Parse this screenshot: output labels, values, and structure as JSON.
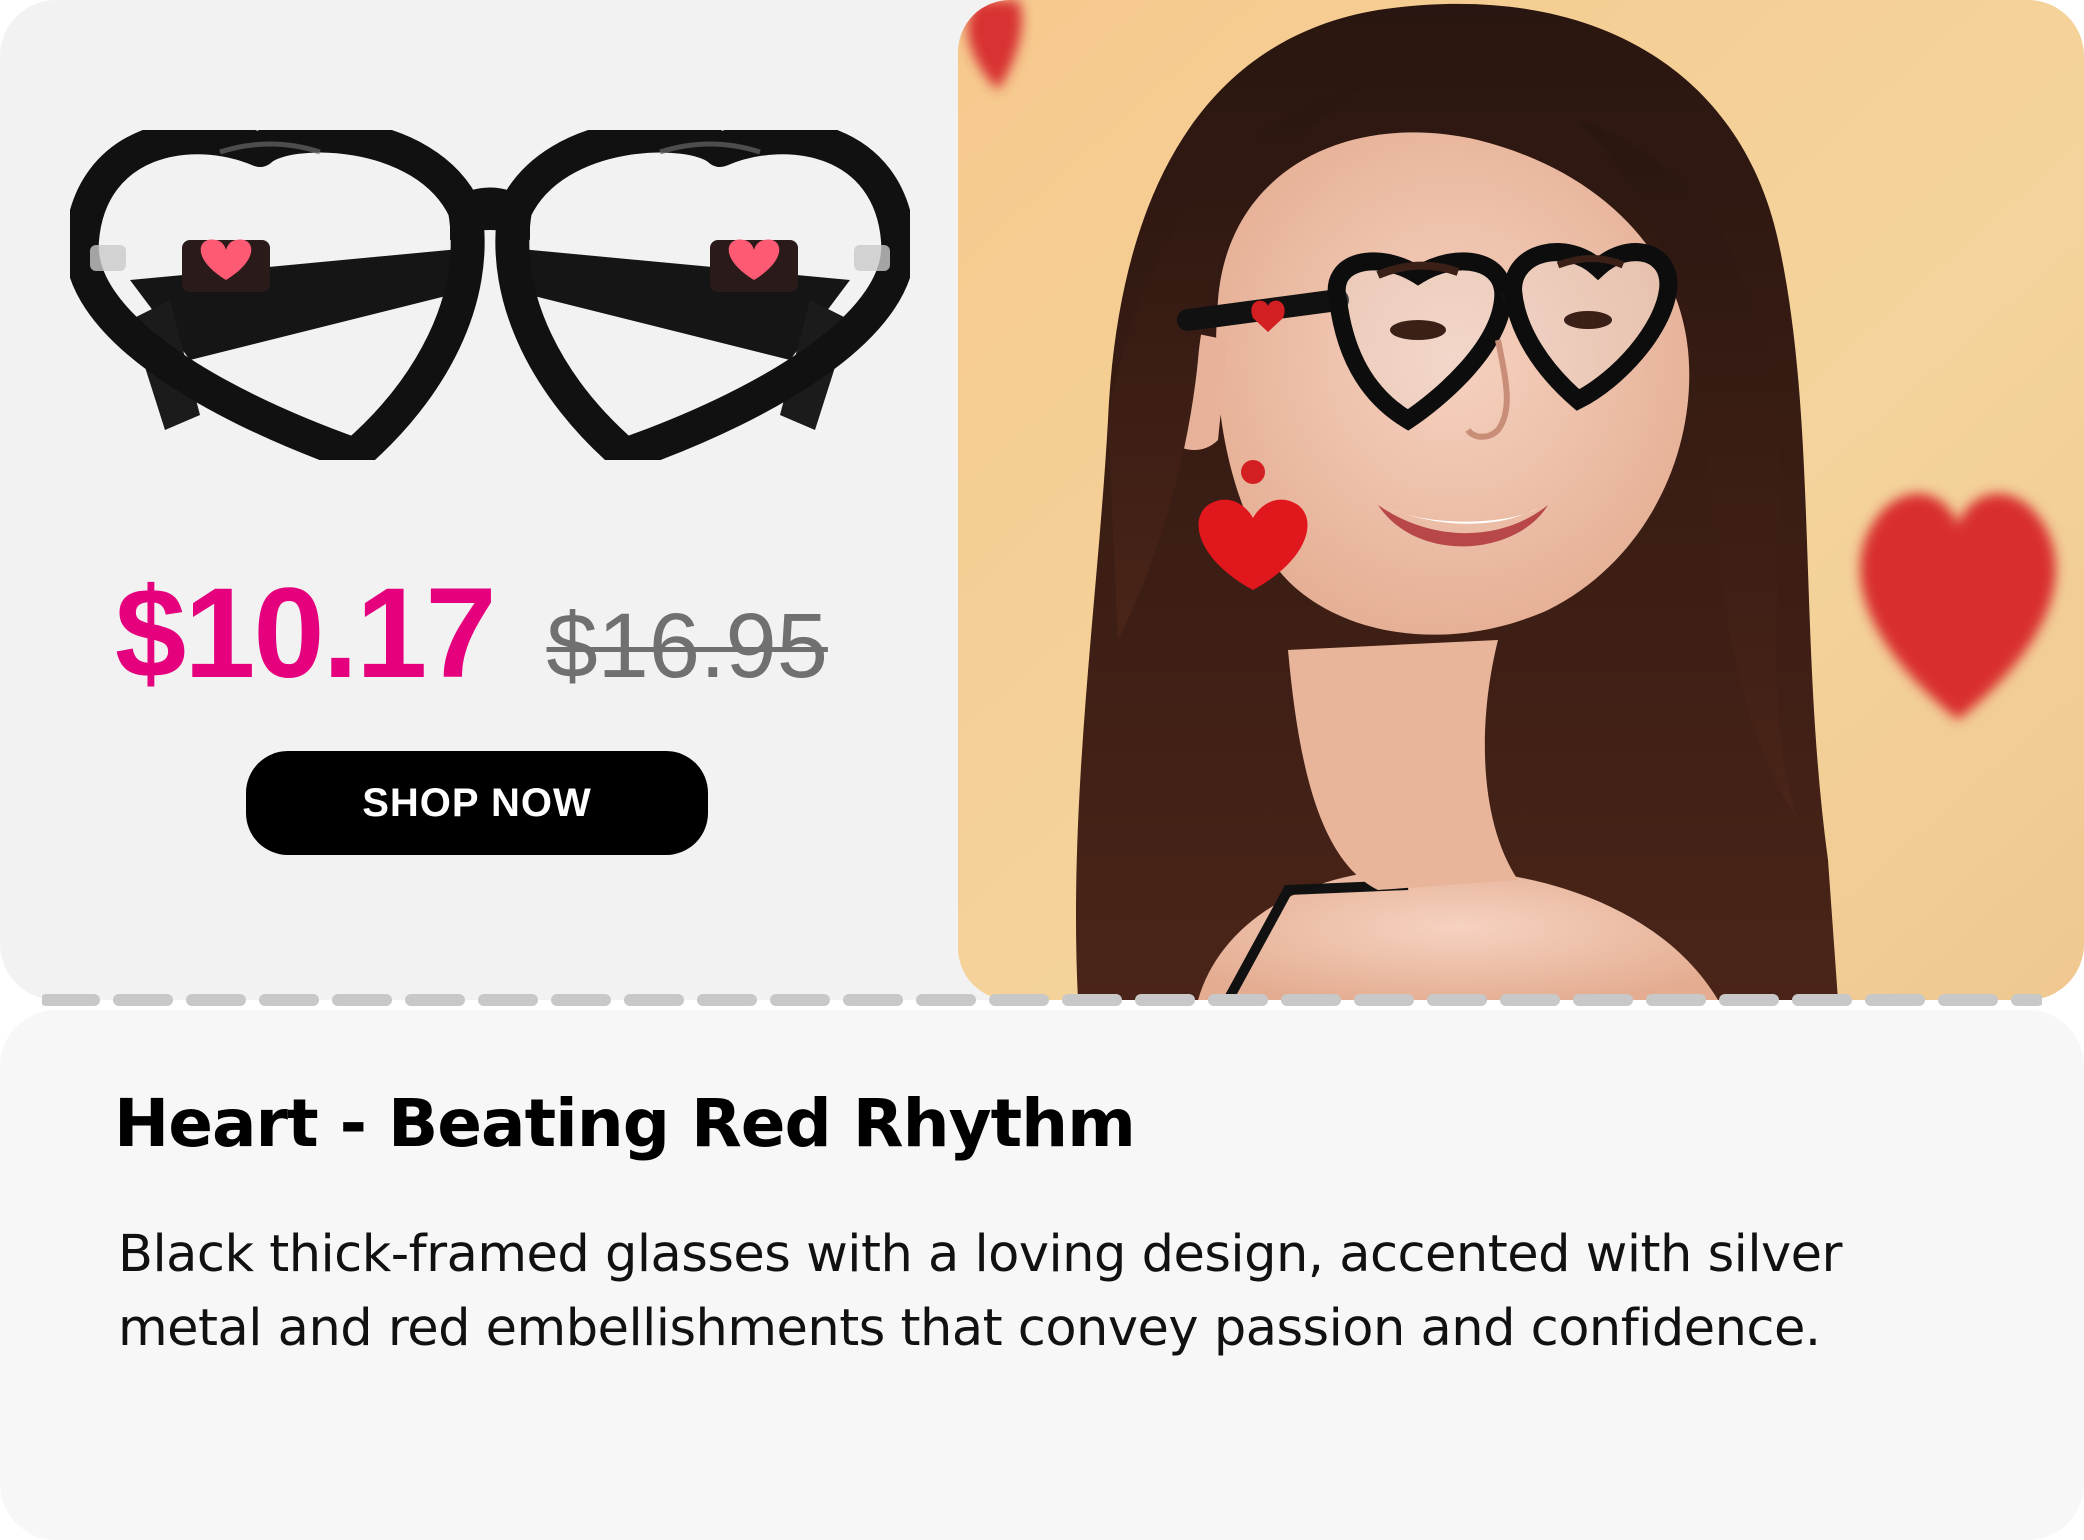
{
  "product": {
    "sale_price": "$10.17",
    "original_price": "$16.95",
    "cta_label": "SHOP NOW",
    "title": "Heart - Beating Red Rhythm",
    "description": "Black thick-framed glasses with a loving design, accented with silver metal and red embellishments that convey passion and confidence."
  },
  "colors": {
    "sale_price": "#e5007d",
    "original_price": "#707070",
    "button_bg": "#000000",
    "card_bg": "#f2f2f2"
  },
  "images": {
    "product": "heart-shaped-black-glasses-icon",
    "model": "model-wearing-heart-glasses-photo"
  }
}
